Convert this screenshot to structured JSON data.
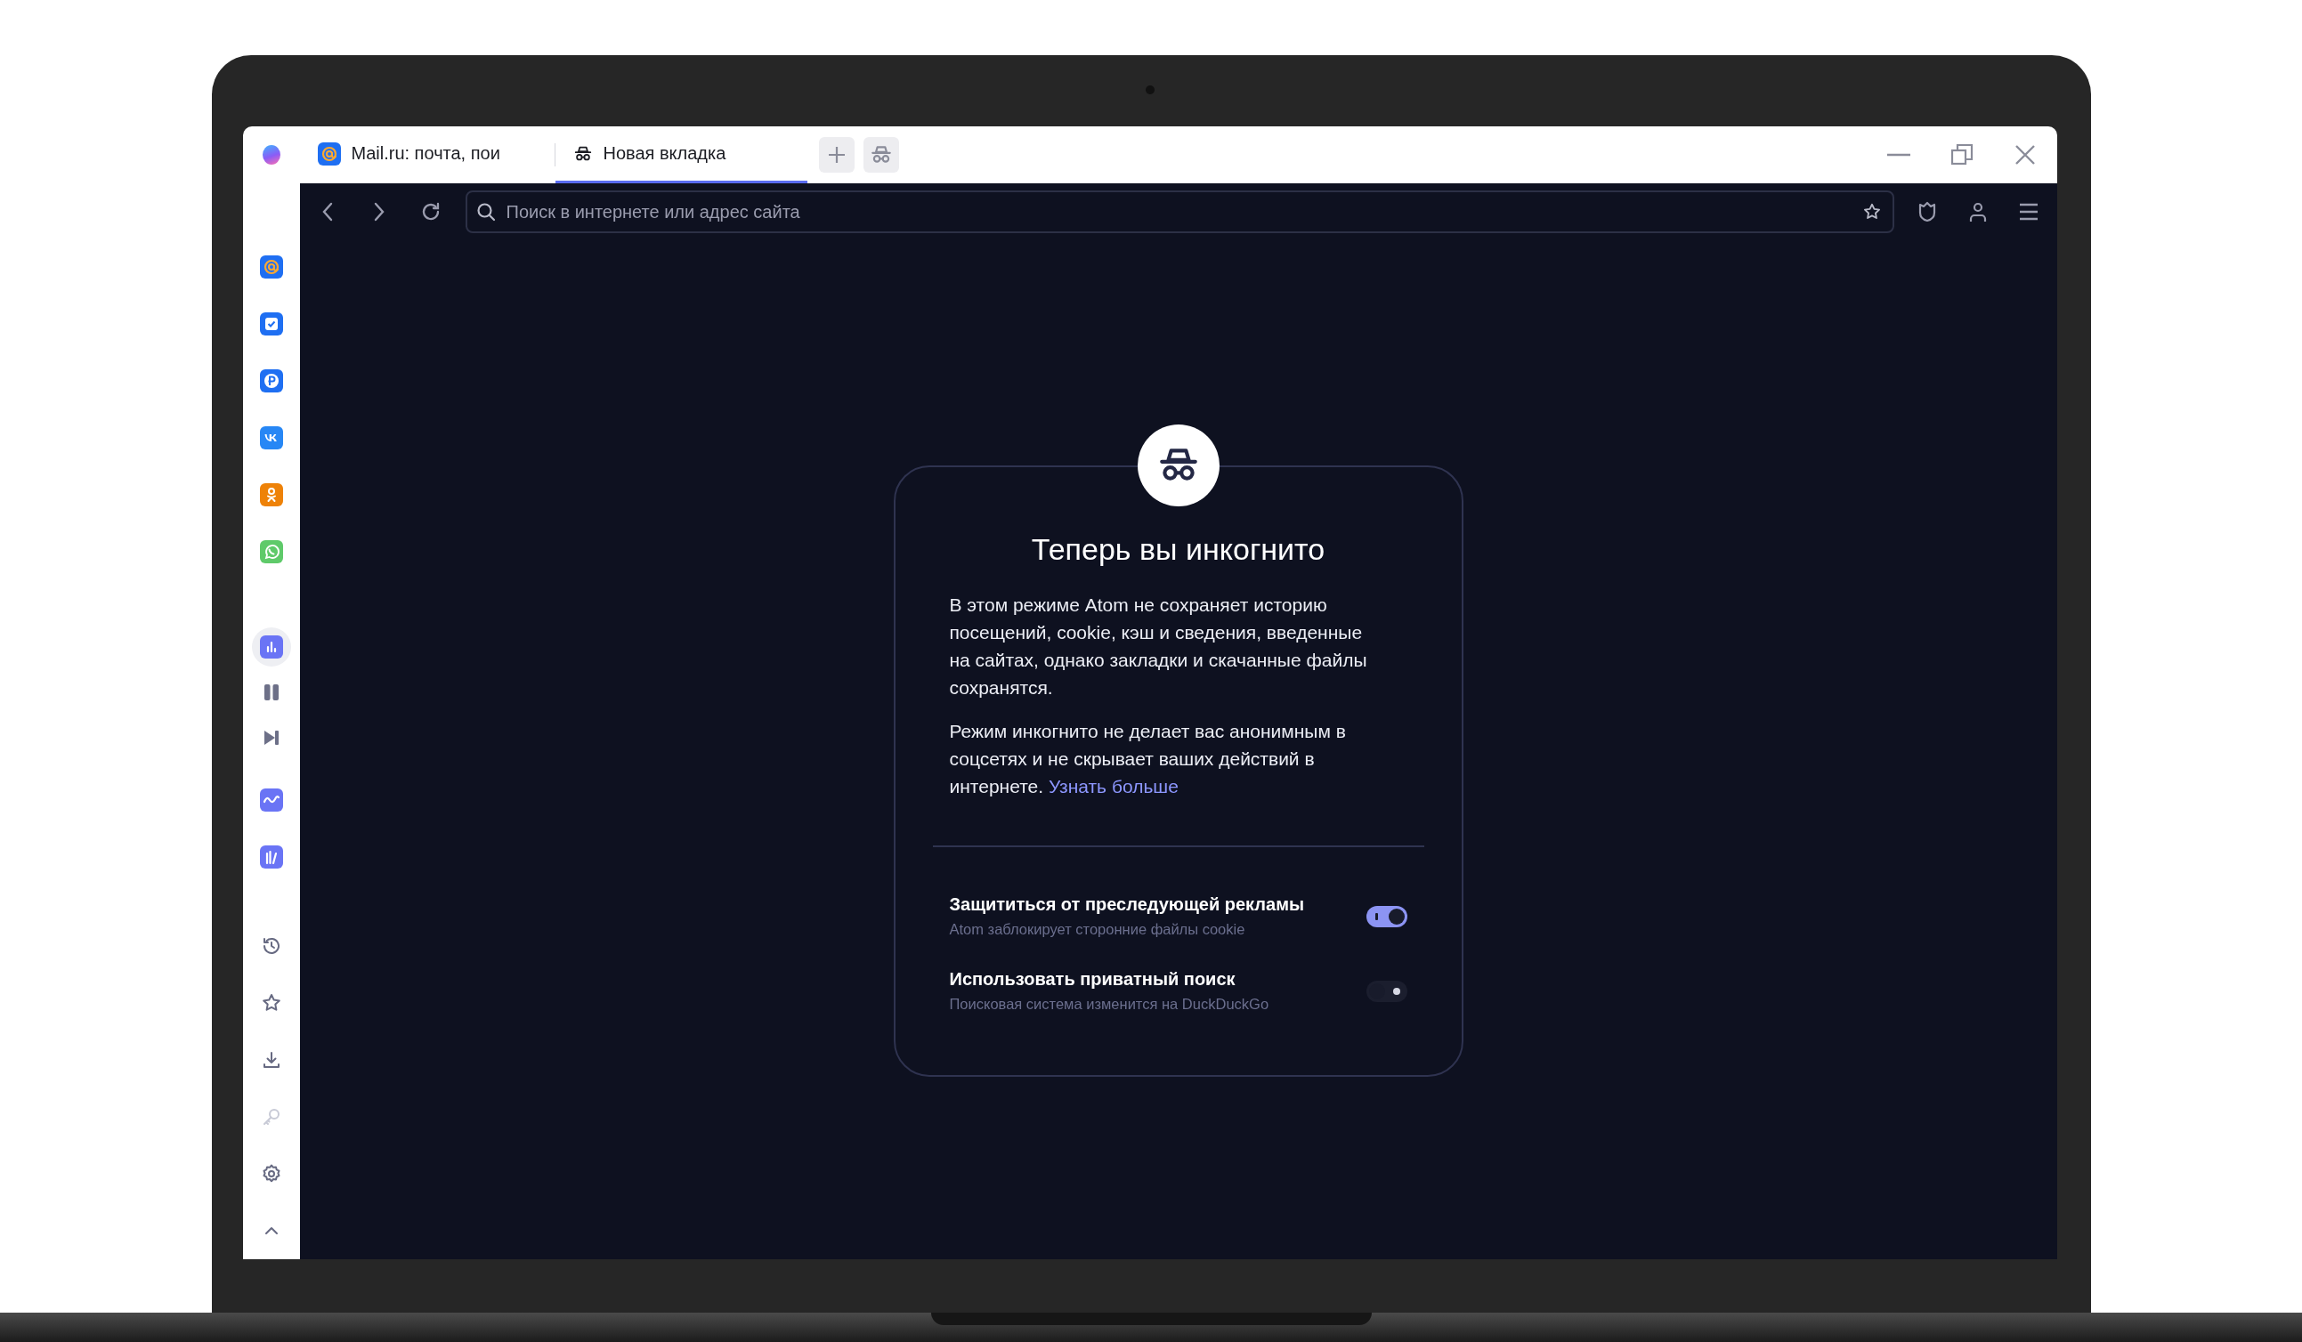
{
  "tabs": [
    {
      "kind": "mail",
      "title": "Mail.ru: почта, пои",
      "selected": false
    },
    {
      "kind": "incognito",
      "title": "Новая вкладка",
      "selected": true
    }
  ],
  "address_bar": {
    "placeholder": "Поиск в интернете или адрес сайта"
  },
  "sidebar": {
    "services": [
      {
        "kind": "mail"
      },
      {
        "kind": "tasks"
      },
      {
        "kind": "money"
      },
      {
        "kind": "vk"
      },
      {
        "kind": "ok"
      },
      {
        "kind": "whatsapp"
      }
    ],
    "player": [
      {
        "kind": "chart",
        "selected": true
      },
      {
        "kind": "pause",
        "selected": false
      },
      {
        "kind": "next",
        "selected": false
      }
    ],
    "apps": [
      {
        "kind": "wave"
      },
      {
        "kind": "books"
      }
    ],
    "tools": [
      {
        "kind": "history",
        "disabled": false
      },
      {
        "kind": "star",
        "disabled": false
      },
      {
        "kind": "download",
        "disabled": false
      },
      {
        "kind": "key",
        "disabled": true
      },
      {
        "kind": "gear",
        "disabled": false
      },
      {
        "kind": "chevron",
        "disabled": false
      }
    ]
  },
  "incognito_card": {
    "title": "Теперь вы инкогнито",
    "paragraphs": [
      {
        "text": "В этом режиме Atom не сохраняет историю посещений, cookie, кэш и сведения, введенные на сайтах, однако закладки и скачанные файлы сохранятся."
      },
      {
        "text": "Режим инкогнито не делает вас анонимным в соцсетях и не скрывает ваших действий в интернете.",
        "link": "Узнать больше"
      }
    ],
    "options": [
      {
        "title": "Защититься от преследующей рекламы",
        "subtitle": "Atom заблокирует сторонние файлы cookie",
        "on": true
      },
      {
        "title": "Использовать приватный поиск",
        "subtitle": "Поисковая система изменится на DuckDuckGo",
        "on": false
      }
    ]
  }
}
